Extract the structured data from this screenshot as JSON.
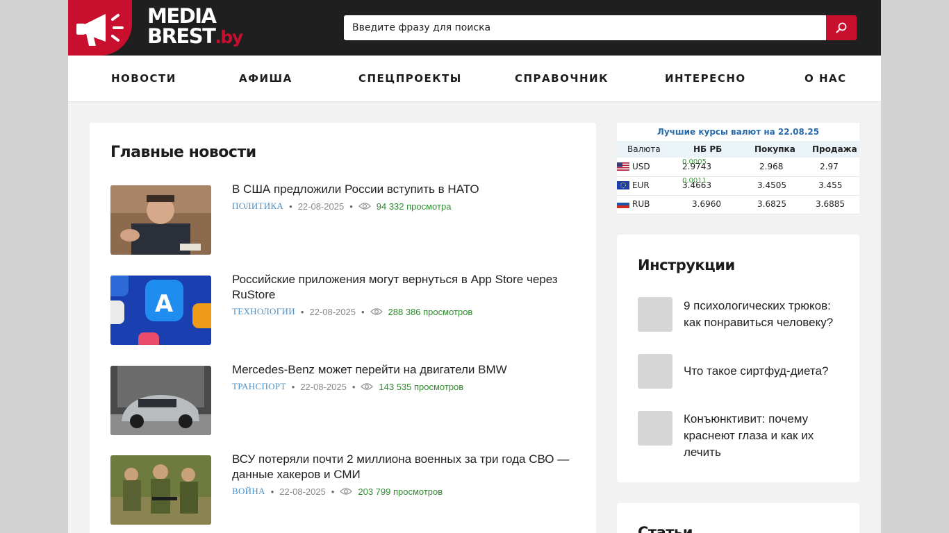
{
  "brand": {
    "line1": "MEDIA",
    "line2": "BREST",
    "suffix": ".by",
    "accent": "#c8102e"
  },
  "search": {
    "placeholder": "Введите фразу для поиска"
  },
  "nav": {
    "items": [
      "НОВОСТИ",
      "АФИША",
      "СПЕЦПРОЕКТЫ",
      "СПРАВОЧНИК",
      "ИНТЕРЕСНО",
      "О НАС"
    ]
  },
  "main": {
    "title": "Главные новости",
    "news": [
      {
        "title": "В США предложили России вступить в НАТО",
        "category": "ПОЛИТИКА",
        "date": "22-08-2025",
        "views": "94 332 просмотра"
      },
      {
        "title": "Российские приложения могут вернуться в App Store через RuStore",
        "category": "ТЕХНОЛОГИИ",
        "date": "22-08-2025",
        "views": "288 386 просмотров"
      },
      {
        "title": "Mercedes-Benz может перейти на двигатели BMW",
        "category": "ТРАНСПОРТ",
        "date": "22-08-2025",
        "views": "143 535 просмотров"
      },
      {
        "title": "ВСУ потеряли почти 2 миллиона военных за три года СВО — данные хакеров и СМИ",
        "category": "ВОЙНА",
        "date": "22-08-2025",
        "views": "203 799 просмотров"
      }
    ]
  },
  "currency": {
    "header": "Лучшие курсы валют на 22.08.25",
    "columns": [
      "Валюта",
      "НБ РБ",
      "Покупка",
      "Продажа"
    ],
    "rows": [
      {
        "code": "USD",
        "nbrb": "2.9743",
        "diff": "0.0005",
        "buy": "2.968",
        "sell": "2.97"
      },
      {
        "code": "EUR",
        "nbrb": "3.4663",
        "diff": "0.0011",
        "buy": "3.4505",
        "sell": "3.455"
      },
      {
        "code": "RUB",
        "nbrb": "3.6960",
        "diff": "",
        "buy": "3.6825",
        "sell": "3.6885"
      }
    ]
  },
  "instructions": {
    "title": "Инструкции",
    "items": [
      "9 психологических трюков: как понравиться человеку?",
      "Что такое сиртфуд-диета?",
      "Конъюнктивит: почему краснеют глаза и как их лечить"
    ]
  },
  "articles": {
    "title": "Статьи"
  }
}
